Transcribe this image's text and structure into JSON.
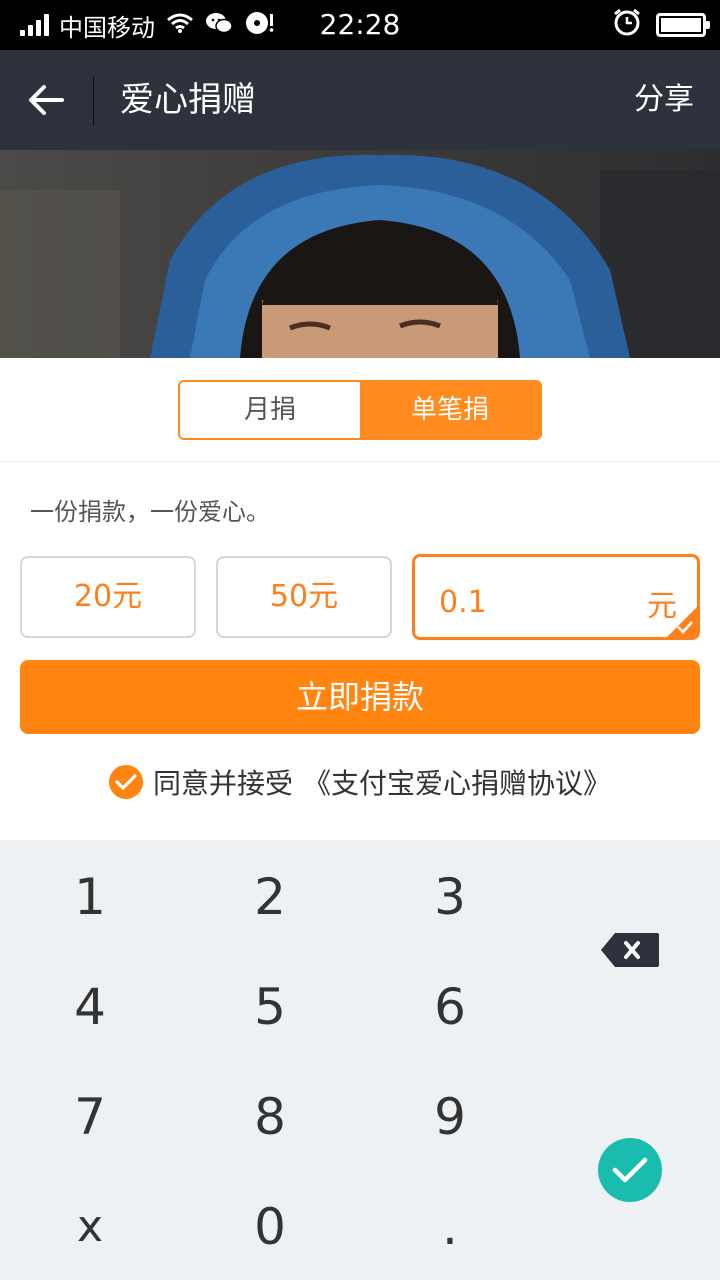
{
  "status_bar": {
    "carrier": "中国移动",
    "time": "22:28"
  },
  "header": {
    "title": "爱心捐赠",
    "share_label": "分享"
  },
  "segment": {
    "tabs": [
      {
        "label": "月捐",
        "active": false
      },
      {
        "label": "单笔捐",
        "active": true
      }
    ]
  },
  "donation": {
    "slogan": "一份捐款，一份爱心。",
    "options": [
      "20元",
      "50元"
    ],
    "custom_value": "0.1",
    "custom_unit": "元",
    "submit_label": "立即捐款",
    "agreement_text": "同意并接受",
    "agreement_link": "《支付宝爱心捐赠协议》",
    "agreed": true
  },
  "keypad": {
    "keys": [
      "1",
      "2",
      "3",
      "4",
      "5",
      "6",
      "7",
      "8",
      "9",
      "x",
      "0",
      "."
    ]
  },
  "colors": {
    "accent": "#ff8410",
    "header_bg": "#2d323c",
    "confirm": "#1bbcb0"
  }
}
